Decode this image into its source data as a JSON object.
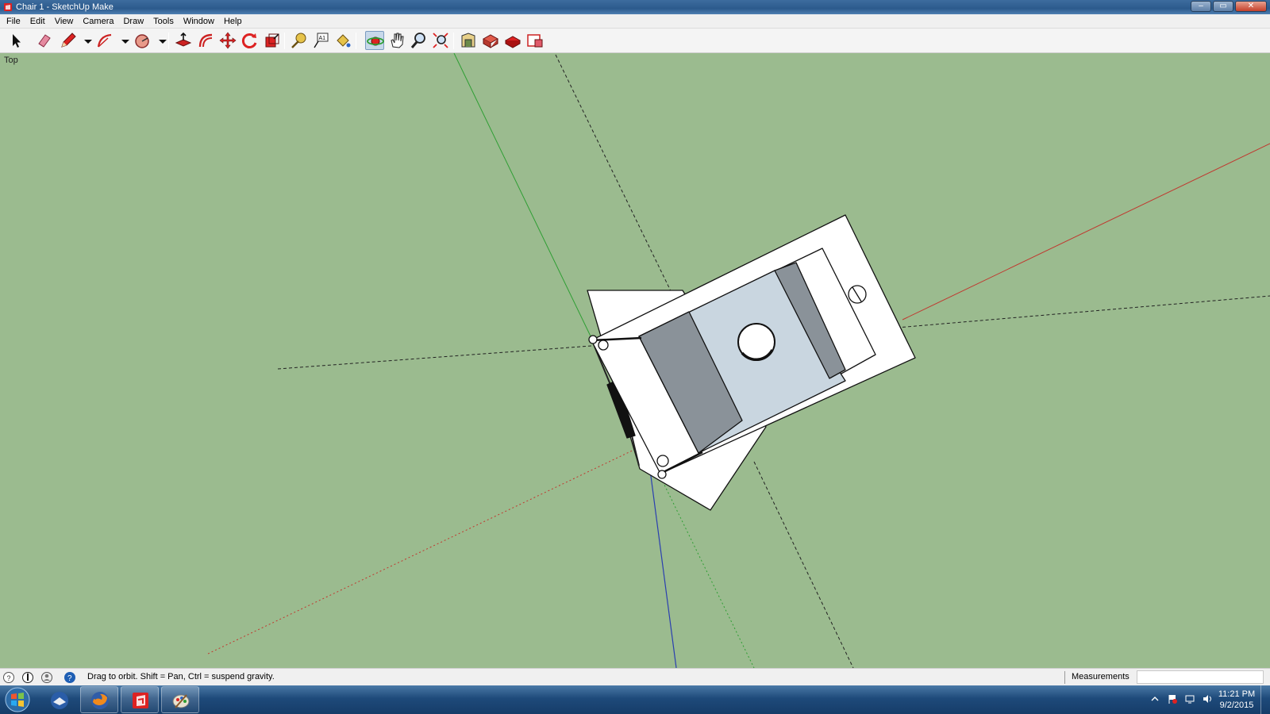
{
  "window": {
    "title": "Chair 1 - SketchUp Make"
  },
  "menu": [
    "File",
    "Edit",
    "View",
    "Camera",
    "Draw",
    "Tools",
    "Window",
    "Help"
  ],
  "toolbar": {
    "tools": [
      {
        "name": "select-tool-icon",
        "active": false
      },
      {
        "name": "eraser-tool-icon",
        "active": false
      },
      {
        "name": "pencil-line-tool-icon",
        "active": false
      },
      {
        "name": "line-dropdown-arrow-icon",
        "active": false
      },
      {
        "name": "arc-tool-icon",
        "active": false
      },
      {
        "name": "arc-dropdown-arrow-icon",
        "active": false
      },
      {
        "name": "circle-tool-icon",
        "active": false
      },
      {
        "name": "circle-dropdown-arrow-icon",
        "active": false
      },
      {
        "name": "push-pull-tool-icon",
        "active": false
      },
      {
        "name": "offset-tool-icon",
        "active": false
      },
      {
        "name": "move-tool-icon",
        "active": false
      },
      {
        "name": "rotate-tool-icon",
        "active": false
      },
      {
        "name": "scale-tool-icon",
        "active": false
      },
      {
        "name": "tape-measure-tool-icon",
        "active": false
      },
      {
        "name": "text-tool-icon",
        "active": false
      },
      {
        "name": "paint-bucket-tool-icon",
        "active": false
      },
      {
        "name": "orbit-tool-icon",
        "active": true
      },
      {
        "name": "pan-tool-icon",
        "active": false
      },
      {
        "name": "zoom-tool-icon",
        "active": false
      },
      {
        "name": "zoom-extents-tool-icon",
        "active": false
      },
      {
        "name": "warehouse-icon",
        "active": false
      },
      {
        "name": "extension-warehouse-icon",
        "active": false
      },
      {
        "name": "share-model-icon",
        "active": false
      },
      {
        "name": "layout-icon",
        "active": false
      }
    ]
  },
  "viewport": {
    "view_label": "Top",
    "background": "#9bbb8f",
    "axis_colors": {
      "red": "#c0382f",
      "green": "#2e9e33",
      "blue": "#2a3fb0"
    }
  },
  "status": {
    "hint": "Drag to orbit. Shift = Pan, Ctrl = suspend gravity.",
    "measurements_label": "Measurements",
    "measurements_value": ""
  },
  "taskbar": {
    "apps": [
      "thunderbird-icon",
      "firefox-icon",
      "sketchup-icon",
      "paint-icon"
    ],
    "time": "11:21 PM",
    "date": "9/2/2015"
  }
}
